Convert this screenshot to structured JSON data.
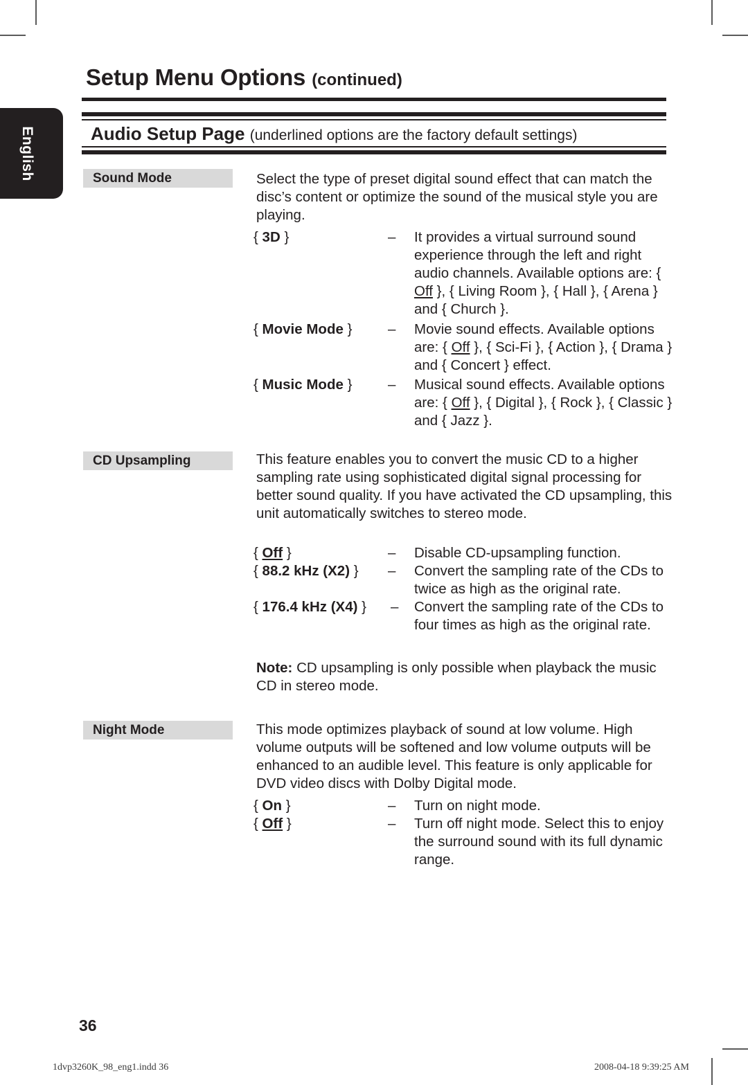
{
  "header": {
    "chapter_title": "Setup Menu Options",
    "chapter_title_suffix": "(continued)",
    "section_title": "Audio Setup Page",
    "section_note": "(underlined options are the factory default settings)"
  },
  "sidebar": {
    "language_tab": "English"
  },
  "sections": [
    {
      "term": "Sound Mode",
      "description": "Select the type of preset digital sound effect that can match the disc’s content or optimize the sound of the musical style you are playing.",
      "options": [
        {
          "label_prefix": "{ ",
          "label_bold": "3D",
          "label_suffix": " }",
          "dash": "–",
          "description": "It provides a virtual surround sound experience through the left and right audio channels. Available options are: { Off }, { Living Room }, { Hall }, { Arena } and { Church }.",
          "default_value": "Off"
        },
        {
          "label_prefix": "{ ",
          "label_bold": "Movie Mode",
          "label_suffix": " }",
          "dash": "–",
          "description": "Movie sound effects. Available options are: { Off }, { Sci-Fi }, { Action }, { Drama } and { Concert } effect.",
          "default_value": "Off"
        },
        {
          "label_prefix": "{ ",
          "label_bold": "Music Mode",
          "label_suffix": " }",
          "dash": "–",
          "description": "Musical sound effects. Available options are: { Off }, { Digital }, { Rock }, { Classic } and { Jazz }.",
          "default_value": "Off"
        }
      ]
    },
    {
      "term": "CD Upsampling",
      "description": "This feature enables you to convert the music CD to a higher sampling rate using sophisticated digital signal processing for better sound quality. If you have activated the CD upsampling, this unit automatically switches to stereo mode.",
      "options": [
        {
          "label_prefix": "{ ",
          "label_bold": "Off",
          "label_suffix": " }",
          "label_bold_underlined": true,
          "dash": "–",
          "description": "Disable CD-upsampling function."
        },
        {
          "label_prefix": "{ ",
          "label_bold": "88.2 kHz (X2)",
          "label_suffix": " }",
          "dash": "–",
          "description": "Convert the sampling rate of the CDs to twice as high as the original rate."
        },
        {
          "label_prefix": "{ ",
          "label_bold": "176.4 kHz (X4)",
          "label_suffix": " }",
          "dash": "–",
          "description": "Convert the sampling rate of the CDs to four times as high as the original rate."
        }
      ],
      "note_label": "Note:",
      "note_text": " CD upsampling is only possible when playback the music CD in stereo mode."
    },
    {
      "term": "Night Mode",
      "description": "This mode optimizes playback of sound at low volume. High volume outputs will be softened and low volume outputs will be enhanced to an audible level. This feature is only applicable for DVD video discs with Dolby Digital mode.",
      "options": [
        {
          "label_prefix": "{ ",
          "label_bold": "On",
          "label_suffix": " }",
          "dash": "–",
          "description": "Turn on night mode."
        },
        {
          "label_prefix": "{ ",
          "label_bold": "Off",
          "label_suffix": " }",
          "label_bold_underlined": true,
          "dash": "–",
          "description": "Turn off night mode. Select this to enjoy the surround sound with its full dynamic range."
        }
      ]
    }
  ],
  "footer": {
    "page_number": "36",
    "file_name": "1dvp3260K_98_eng1.indd   36",
    "timestamp": "2008-04-18   9:39:25 AM"
  },
  "colors": {
    "ink": "#231f20",
    "term_box": "#d9d9d9",
    "crop_mark": "#5a5a5a"
  }
}
